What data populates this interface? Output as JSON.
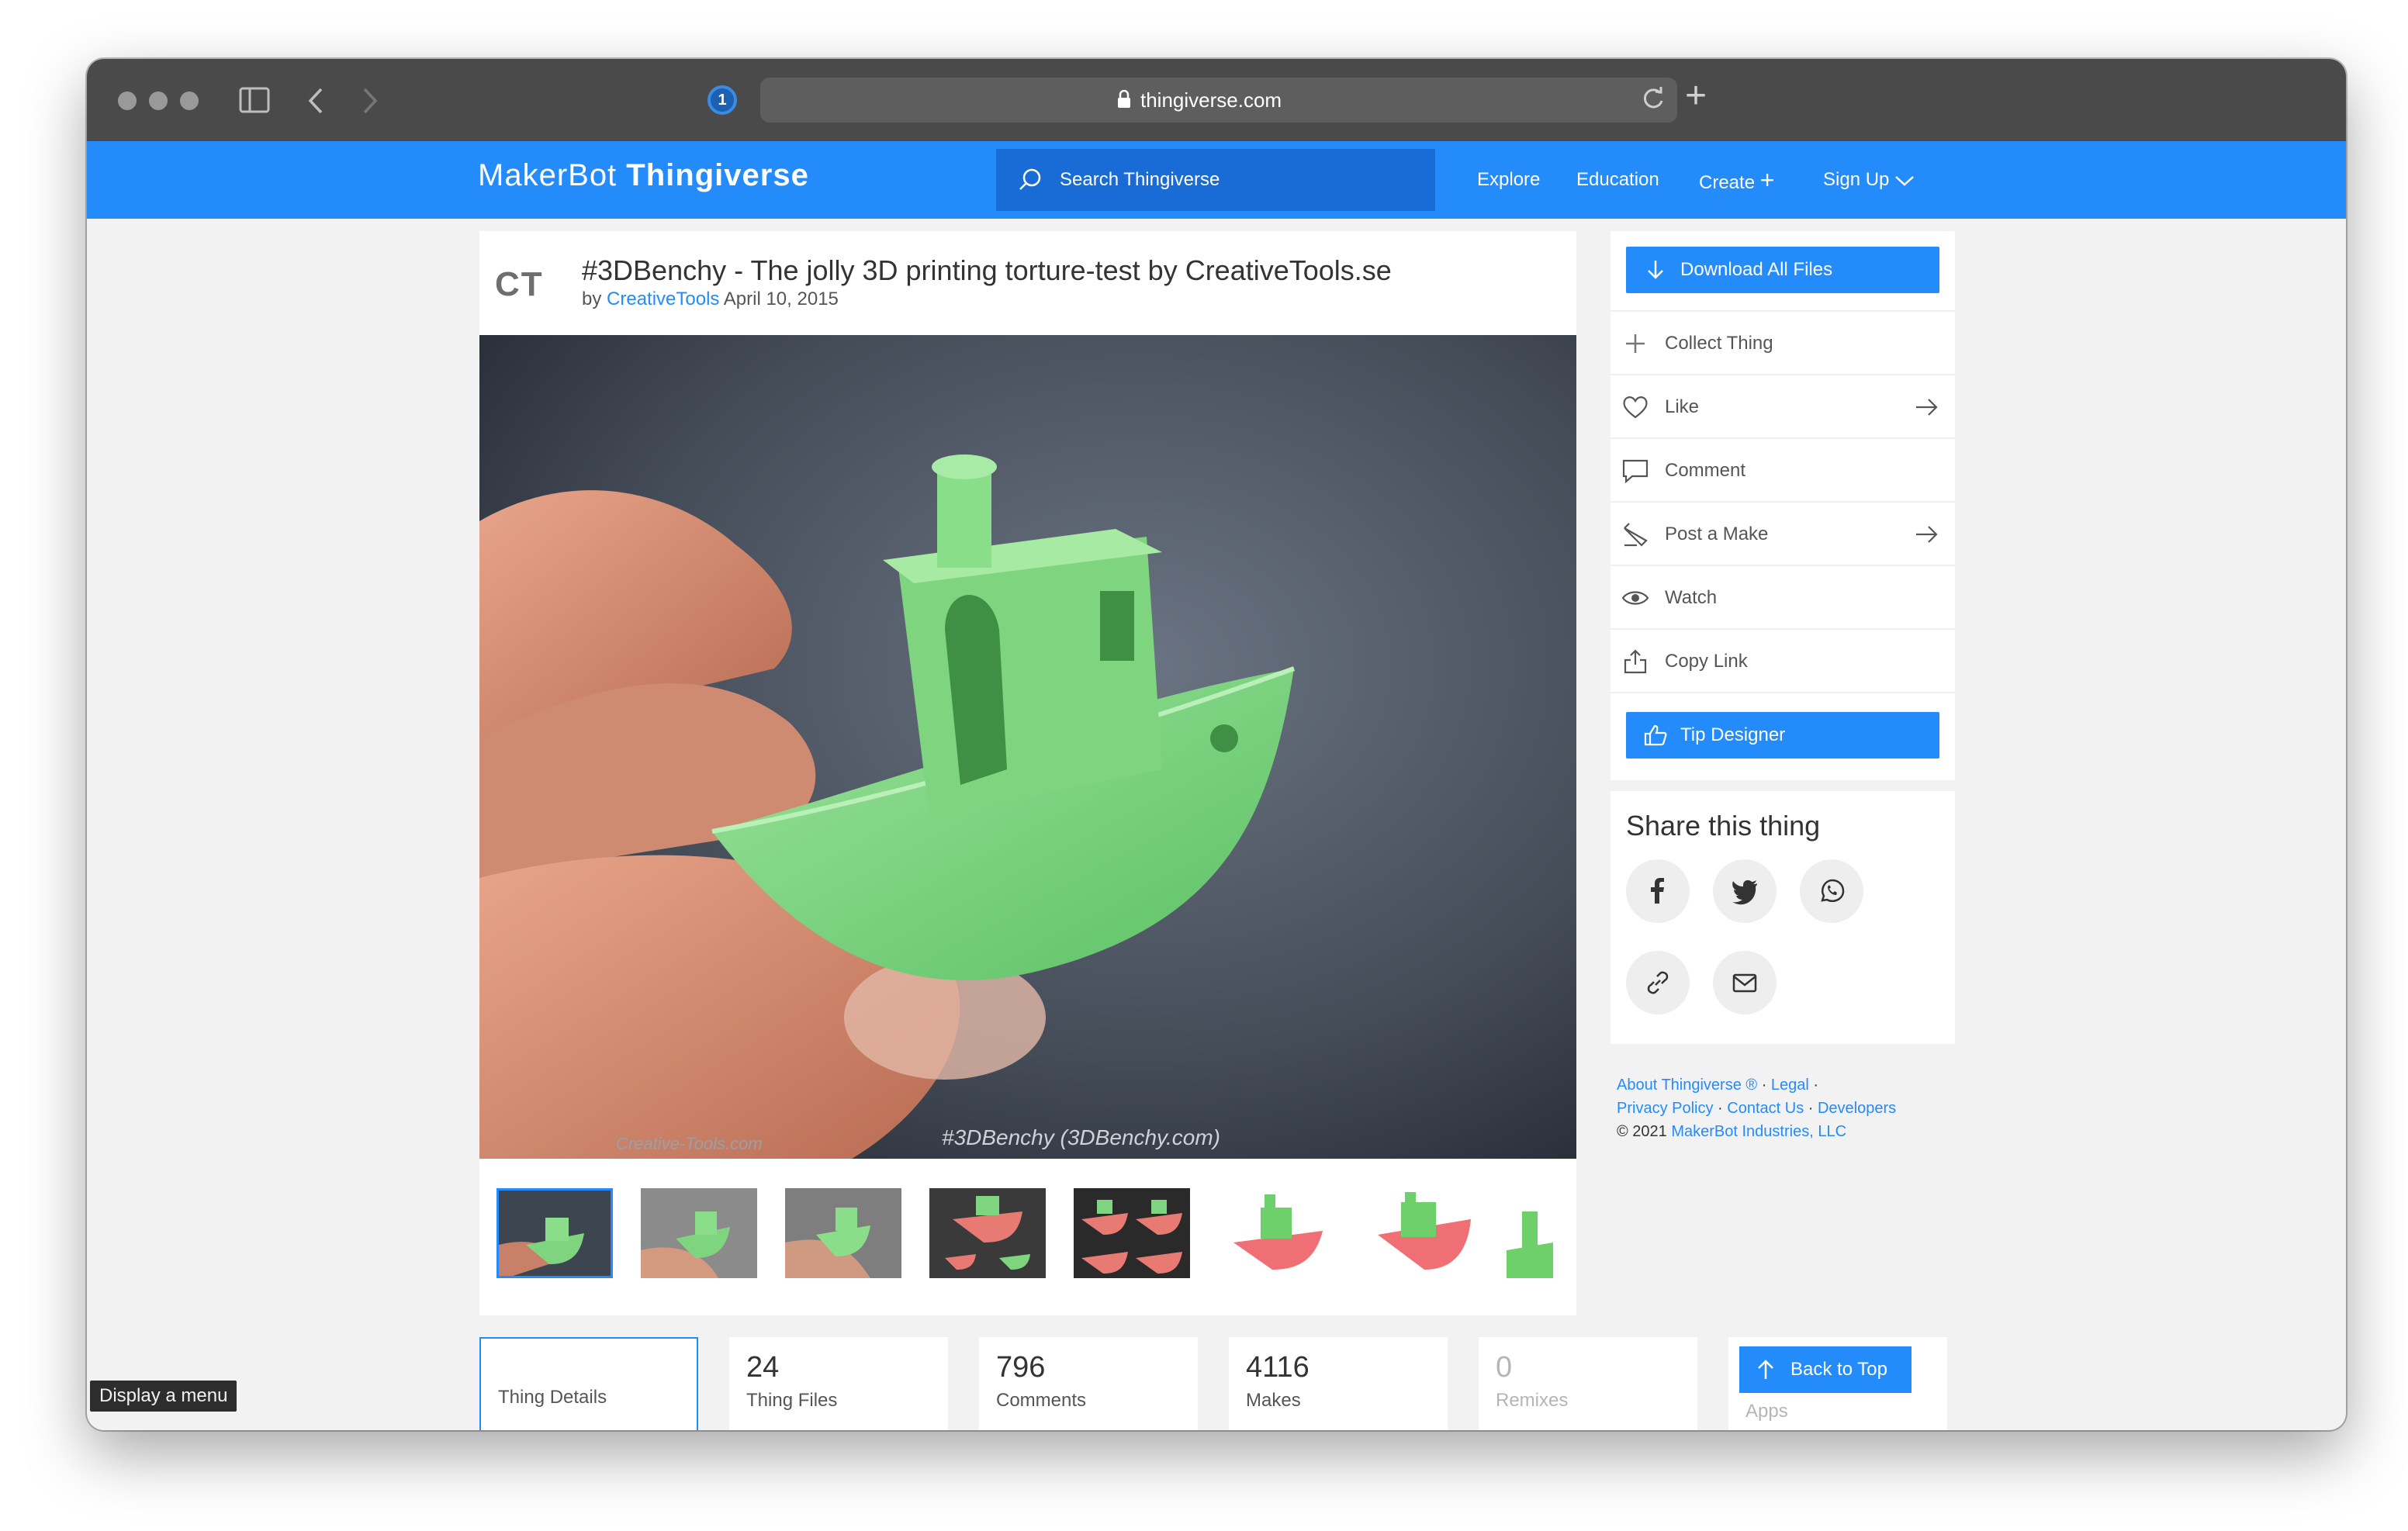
{
  "browser": {
    "url": "thingiverse.com"
  },
  "header": {
    "logo_prefix": "MakerBot",
    "logo_name": "Thingiverse",
    "search_placeholder": "Search Thingiverse",
    "nav": [
      "Explore",
      "Education",
      "Create",
      "Sign Up"
    ],
    "brand_color": "#248bfb"
  },
  "thing": {
    "avatar_text": "CT",
    "title": "#3DBenchy - The jolly 3D printing torture-test by CreativeTools.se",
    "by": "by",
    "author": "CreativeTools",
    "date": "April 10, 2015",
    "watermark_left": "Creative-Tools.com",
    "watermark_right": "#3DBenchy (3DBenchy.com)"
  },
  "actions": {
    "download": "Download All Files",
    "items": [
      "Collect Thing",
      "Like",
      "Comment",
      "Post a Make",
      "Watch",
      "Copy Link"
    ],
    "tip": "Tip Designer"
  },
  "share": {
    "title": "Share this thing",
    "icons": [
      "facebook-icon",
      "twitter-icon",
      "whatsapp-icon",
      "link-icon",
      "email-icon"
    ]
  },
  "footer": {
    "about": "About Thingiverse ®",
    "legal": "Legal",
    "privacy": "Privacy Policy",
    "contact": "Contact Us",
    "developers": "Developers",
    "copyright_prefix": "© 2021",
    "company": "MakerBot Industries, LLC"
  },
  "stats": [
    {
      "num": "",
      "label": "Thing Details"
    },
    {
      "num": "24",
      "label": "Thing Files"
    },
    {
      "num": "796",
      "label": "Comments"
    },
    {
      "num": "4116",
      "label": "Makes"
    },
    {
      "num": "0",
      "label": "Remixes"
    },
    {
      "num": "",
      "label": "Apps"
    }
  ],
  "back_to_top": "Back to Top",
  "tooltip": "Display a menu"
}
